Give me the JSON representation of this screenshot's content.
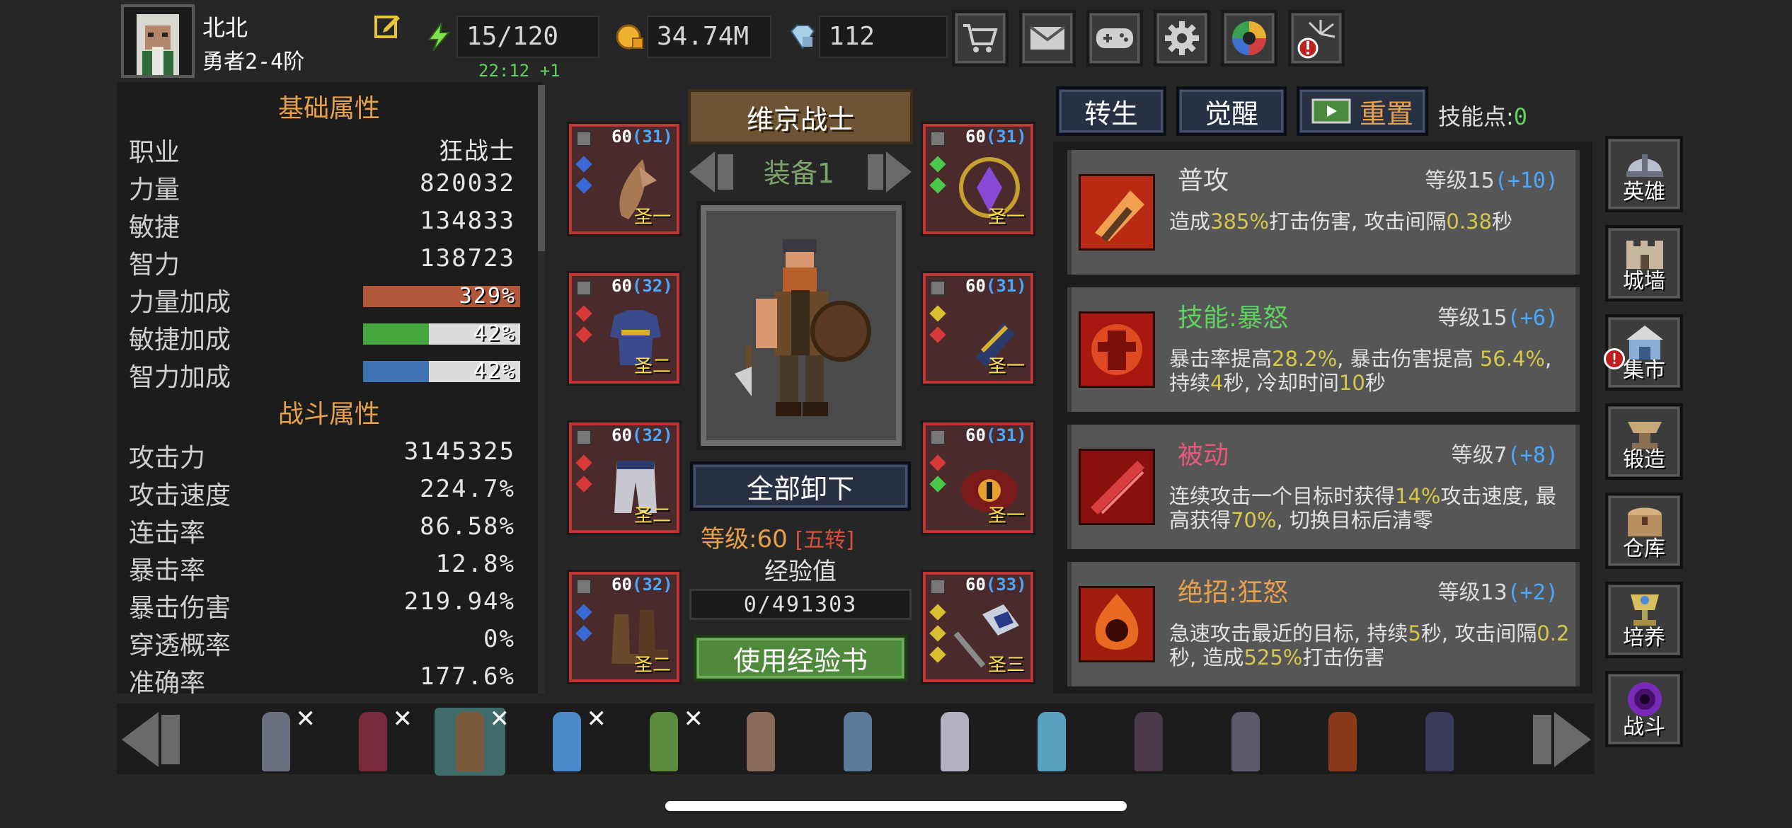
{
  "player": {
    "name": "北北",
    "rank": "勇者2-4阶"
  },
  "resources": {
    "energy": "15/120",
    "regen": "22:12 +1",
    "gold": "34.74M",
    "gems": "112"
  },
  "top_buttons": [
    "cart-icon",
    "mail-icon",
    "gamepad-icon",
    "gear-icon",
    "camera-lens-icon",
    "firework-icon"
  ],
  "stats": {
    "basic_title": "基础属性",
    "combat_title": "战斗属性",
    "basic": [
      {
        "label": "职业",
        "value": "狂战士"
      },
      {
        "label": "力量",
        "value": "820032"
      },
      {
        "label": "敏捷",
        "value": "134833"
      },
      {
        "label": "智力",
        "value": "138723"
      }
    ],
    "bonuses": [
      {
        "label": "力量加成",
        "value": "329%",
        "fill": 1.0,
        "color": "#b3573a"
      },
      {
        "label": "敏捷加成",
        "value": "42%",
        "fill": 0.42,
        "color": "#46a640"
      },
      {
        "label": "智力加成",
        "value": "42%",
        "fill": 0.42,
        "color": "#3f74b4"
      }
    ],
    "combat": [
      {
        "label": "攻击力",
        "value": "3145325"
      },
      {
        "label": "攻击速度",
        "value": "224.7%"
      },
      {
        "label": "连击率",
        "value": "86.58%"
      },
      {
        "label": "暴击率",
        "value": "12.8%"
      },
      {
        "label": "暴击伤害",
        "value": "219.94%"
      },
      {
        "label": "穿透概率",
        "value": "0%"
      },
      {
        "label": "准确率",
        "value": "177.6%"
      }
    ]
  },
  "equipment": {
    "class_banner": "维京战士",
    "set_label": "装备1",
    "slots": [
      {
        "level": "60",
        "plus": "(31)",
        "grade": "圣一",
        "icon": "weapon-claw-icon"
      },
      {
        "level": "60",
        "plus": "(31)",
        "grade": "圣一",
        "icon": "amulet-icon"
      },
      {
        "level": "60",
        "plus": "(32)",
        "grade": "圣二",
        "icon": "armor-icon"
      },
      {
        "level": "60",
        "plus": "(31)",
        "grade": "圣一",
        "icon": "gauntlet-icon"
      },
      {
        "level": "60",
        "plus": "(32)",
        "grade": "圣二",
        "icon": "pants-icon"
      },
      {
        "level": "60",
        "plus": "(31)",
        "grade": "圣一",
        "icon": "ring-eye-icon"
      },
      {
        "level": "60",
        "plus": "(32)",
        "grade": "圣二",
        "icon": "boots-icon"
      },
      {
        "level": "60",
        "plus": "(33)",
        "grade": "圣三",
        "icon": "axe-icon"
      }
    ],
    "unequip_all": "全部卸下",
    "level_label": "等级:60",
    "tier": "[五转]",
    "exp_label": "经验值",
    "exp_value": "0/491303",
    "exp_fill": 0.0,
    "use_exp_book": "使用经验书"
  },
  "skill_tabs": {
    "rebirth": "转生",
    "awaken": "觉醒",
    "reset": "重置",
    "points_label": "技能点:",
    "points": "0"
  },
  "skills": [
    {
      "name": "普攻",
      "name_color": "#e0e0e0",
      "level": "等级15",
      "bonus": "(+10)",
      "desc": [
        {
          "t": "造成"
        },
        {
          "t": "385%",
          "h": true
        },
        {
          "t": "打击伤害, 攻击间隔"
        },
        {
          "t": "0.38",
          "h": true
        },
        {
          "t": "秒"
        }
      ]
    },
    {
      "name": "技能:暴怒",
      "name_color": "#5fd35f",
      "level": "等级15",
      "bonus": "(+6)",
      "desc": [
        {
          "t": "暴击率提高"
        },
        {
          "t": "28.2%",
          "h": true
        },
        {
          "t": ", 暴击伤害提高 "
        },
        {
          "t": "56.4%",
          "h": true
        },
        {
          "t": ", 持续"
        },
        {
          "t": "4",
          "h": true
        },
        {
          "t": "秒, 冷却时间"
        },
        {
          "t": "10",
          "h": true
        },
        {
          "t": "秒"
        }
      ]
    },
    {
      "name": "被动",
      "name_color": "#e8577a",
      "level": "等级7",
      "bonus": "(+8)",
      "desc": [
        {
          "t": "连续攻击一个目标时获得"
        },
        {
          "t": "14%",
          "h": true
        },
        {
          "t": "攻击速度, 最高获得"
        },
        {
          "t": "70%",
          "h": true
        },
        {
          "t": ", 切换目标后清零"
        }
      ]
    },
    {
      "name": "绝招:狂怒",
      "name_color": "#e8a04a",
      "level": "等级13",
      "bonus": "(+2)",
      "desc": [
        {
          "t": "急速攻击最近的目标, 持续"
        },
        {
          "t": "5",
          "h": true
        },
        {
          "t": "秒, 攻击间隔"
        },
        {
          "t": "0.2",
          "h": true
        },
        {
          "t": "秒, 造成"
        },
        {
          "t": "525%",
          "h": true
        },
        {
          "t": "打击伤害"
        }
      ]
    }
  ],
  "nav": [
    {
      "label": "英雄",
      "icon": "helmet-icon",
      "alert": false
    },
    {
      "label": "城墙",
      "icon": "castle-wall-icon",
      "alert": false
    },
    {
      "label": "集市",
      "icon": "market-icon",
      "alert": true
    },
    {
      "label": "锻造",
      "icon": "anvil-icon",
      "alert": false
    },
    {
      "label": "仓库",
      "icon": "chest-icon",
      "alert": false
    },
    {
      "label": "培养",
      "icon": "chalice-icon",
      "alert": false
    },
    {
      "label": "战斗",
      "icon": "portal-icon",
      "alert": false
    }
  ],
  "roster": [
    {
      "color": "#6a6f80",
      "x": true
    },
    {
      "color": "#7a2a3a",
      "x": true
    },
    {
      "color": "#7a5a3a",
      "x": true,
      "selected": true
    },
    {
      "color": "#4a8ac8",
      "x": true
    },
    {
      "color": "#5a8a3a",
      "x": true
    },
    {
      "color": "#8a6a5a",
      "x": false
    },
    {
      "color": "#5a7a9a",
      "x": false
    },
    {
      "color": "#b0b0c0",
      "x": false
    },
    {
      "color": "#5aa0c0",
      "x": false
    },
    {
      "color": "#4a3a4a",
      "x": false
    },
    {
      "color": "#5a5a6a",
      "x": false
    },
    {
      "color": "#8a3a1a",
      "x": false
    },
    {
      "color": "#3a3a5a",
      "x": false
    }
  ]
}
